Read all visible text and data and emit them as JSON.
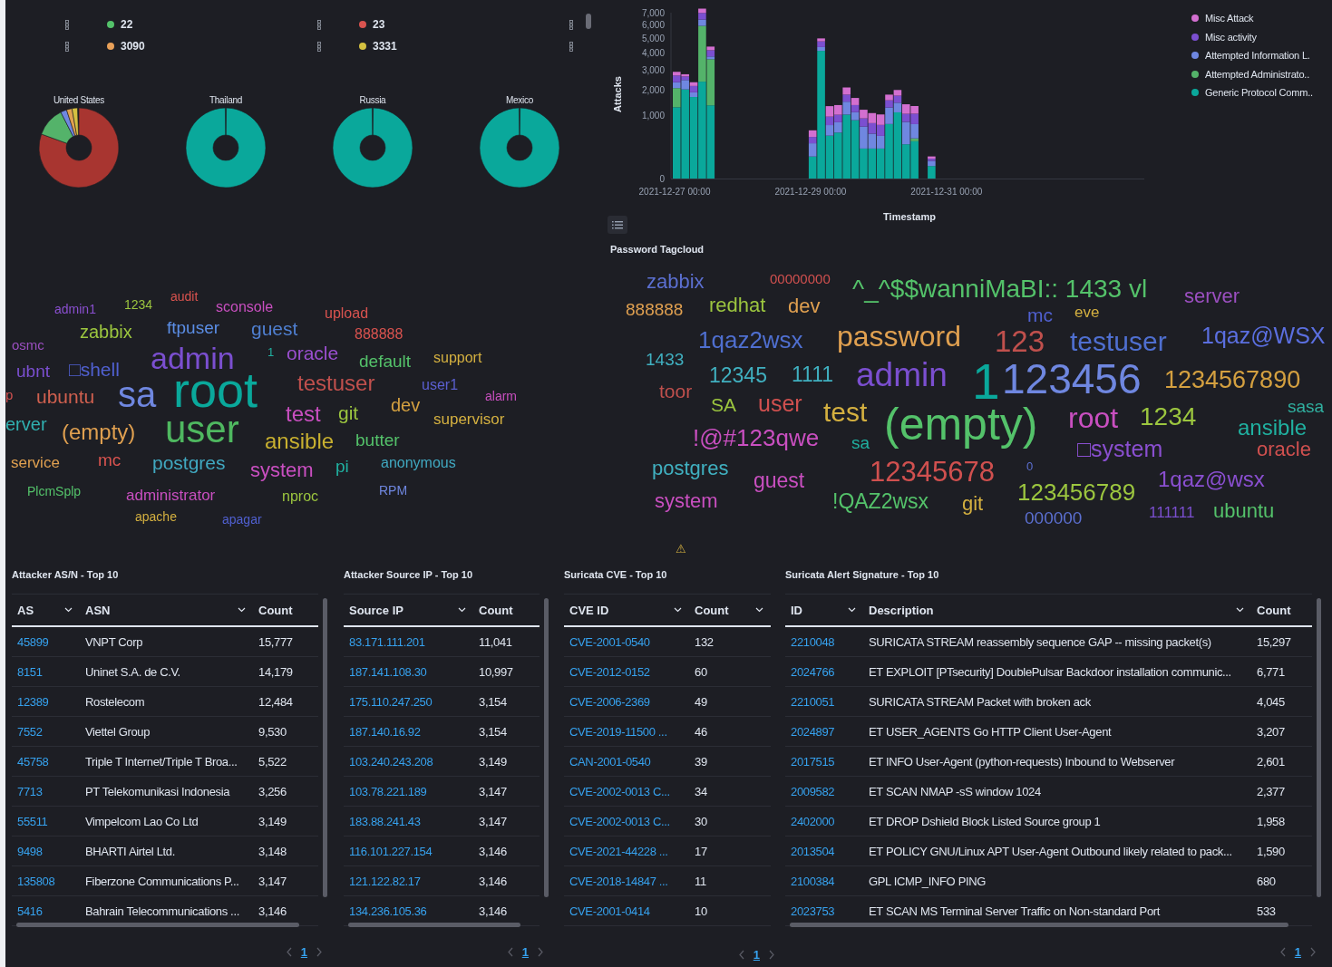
{
  "top_legend": {
    "rows": [
      {
        "items": [
          {
            "label": "22",
            "color": "#54c26a"
          },
          {
            "label": "23",
            "color": "#d9534f"
          }
        ]
      },
      {
        "items": [
          {
            "label": "3090",
            "color": "#e8a058"
          },
          {
            "label": "3331",
            "color": "#d4c040"
          }
        ]
      }
    ]
  },
  "country_donuts": [
    {
      "title": "United States",
      "kind": "mixed"
    },
    {
      "title": "Thailand",
      "kind": "single"
    },
    {
      "title": "Russia",
      "kind": "single"
    },
    {
      "title": "Mexico",
      "kind": "single"
    }
  ],
  "left_tagcloud": {
    "words": [
      {
        "text": "admin1",
        "color": "#8a4fd0"
      },
      {
        "text": "1234",
        "color": "#9cc63f"
      },
      {
        "text": "audit",
        "color": "#d9534f"
      },
      {
        "text": "sconsole",
        "color": "#c94fc0"
      },
      {
        "text": "upload",
        "color": "#d9534f"
      },
      {
        "text": "zabbix",
        "color": "#9cc63f"
      },
      {
        "text": "ftpuser",
        "color": "#5b8ee6"
      },
      {
        "text": "guest",
        "color": "#4f7fd0"
      },
      {
        "text": "888888",
        "color": "#d9534f"
      },
      {
        "text": "osmc",
        "color": "#9b4fc0"
      },
      {
        "text": "admin",
        "color": "#7b4fd0"
      },
      {
        "text": "1",
        "color": "#20b0a0"
      },
      {
        "text": "oracle",
        "color": "#9b4fd0"
      },
      {
        "text": "default",
        "color": "#54c26a"
      },
      {
        "text": "support",
        "color": "#d4b040"
      },
      {
        "text": "ubnt",
        "color": "#7b4fd0"
      },
      {
        "text": "□shell",
        "color": "#5060d0"
      },
      {
        "text": "p",
        "color": "#d0504f"
      },
      {
        "text": "ubuntu",
        "color": "#d0604f"
      },
      {
        "text": "sa",
        "color": "#6f87e0"
      },
      {
        "text": "root",
        "color": "#0aa89b"
      },
      {
        "text": "testuser",
        "color": "#c0504d"
      },
      {
        "text": "user1",
        "color": "#5b5fd0"
      },
      {
        "text": "alarm",
        "color": "#c94fc0"
      },
      {
        "text": "test",
        "color": "#c94fc0"
      },
      {
        "text": "git",
        "color": "#9cc63f"
      },
      {
        "text": "dev",
        "color": "#d4a040"
      },
      {
        "text": "erver",
        "color": "#30b0b0"
      },
      {
        "text": "(empty)",
        "color": "#e0a050"
      },
      {
        "text": "user",
        "color": "#4fb860"
      },
      {
        "text": "supervisor",
        "color": "#d4b040"
      },
      {
        "text": "ansible",
        "color": "#c8b030"
      },
      {
        "text": "butter",
        "color": "#54c26a"
      },
      {
        "text": "service",
        "color": "#e0a050"
      },
      {
        "text": "mc",
        "color": "#d9534f"
      },
      {
        "text": "postgres",
        "color": "#40a8c0"
      },
      {
        "text": "system",
        "color": "#c94fc0"
      },
      {
        "text": "pi",
        "color": "#20b0a0"
      },
      {
        "text": "anonymous",
        "color": "#40a8c0"
      },
      {
        "text": "PlcmSplp",
        "color": "#54c26a"
      },
      {
        "text": "administrator",
        "color": "#c94fc0"
      },
      {
        "text": "nproc",
        "color": "#9cc63f"
      },
      {
        "text": "RPM",
        "color": "#6f87e0"
      },
      {
        "text": "apache",
        "color": "#d4b040"
      },
      {
        "text": "apagar",
        "color": "#5060d0"
      }
    ]
  },
  "attacks_chart": {
    "y_title": "Attacks",
    "x_title": "Timestamp",
    "y_tick_labels": [
      "7,000",
      "6,000",
      "5,000",
      "4,000",
      "3,000",
      "2,000",
      "1,000",
      "0"
    ],
    "x_tick_labels": [
      "2021-12-27 00:00",
      "2021-12-29 00:00",
      "2021-12-31 00:00"
    ],
    "legend": [
      {
        "label": "Misc Attack",
        "color": "#d36fd0"
      },
      {
        "label": "Misc activity",
        "color": "#7b4fd0"
      },
      {
        "label": "Attempted Information L.",
        "color": "#6f87e0"
      },
      {
        "label": "Attempted Administrato..",
        "color": "#54b36a"
      },
      {
        "label": "Generic Protocol Comm..",
        "color": "#0aa89b"
      }
    ]
  },
  "password_tagcloud": {
    "title": "Password Tagcloud",
    "warning": "⚠",
    "words": [
      {
        "text": "zabbix",
        "color": "#5b6fd0"
      },
      {
        "text": "00000000",
        "color": "#d0504f"
      },
      {
        "text": "^_^$$wanniMaBI:: 1433 vl",
        "color": "#54c26a"
      },
      {
        "text": "server",
        "color": "#9b4fc0"
      },
      {
        "text": "888888",
        "color": "#e0a050"
      },
      {
        "text": "redhat",
        "color": "#9cc63f"
      },
      {
        "text": "dev",
        "color": "#e0a050"
      },
      {
        "text": "mc",
        "color": "#5060d0"
      },
      {
        "text": "eve",
        "color": "#d4b040"
      },
      {
        "text": "1qaz2wsx",
        "color": "#4f6fd0"
      },
      {
        "text": "password",
        "color": "#e0a050"
      },
      {
        "text": "123",
        "color": "#c0504d"
      },
      {
        "text": "testuser",
        "color": "#4f6fd0"
      },
      {
        "text": "1qaz@WSX",
        "color": "#5b6fe0"
      },
      {
        "text": "1433",
        "color": "#40b0c0"
      },
      {
        "text": "12345",
        "color": "#40b0c0"
      },
      {
        "text": "1111",
        "color": "#40b0c0"
      },
      {
        "text": "admin",
        "color": "#7b4fd0"
      },
      {
        "text": "1",
        "color": "#0aa89b"
      },
      {
        "text": "123456",
        "color": "#6f87e0"
      },
      {
        "text": "1234567890",
        "color": "#d4a040"
      },
      {
        "text": "toor",
        "color": "#c0504d"
      },
      {
        "text": "SA",
        "color": "#9cc63f"
      },
      {
        "text": "user",
        "color": "#d0504f"
      },
      {
        "text": "test",
        "color": "#d4b040"
      },
      {
        "text": "(empty)",
        "color": "#54c26a"
      },
      {
        "text": "root",
        "color": "#c94fc0"
      },
      {
        "text": "1234",
        "color": "#9cc63f"
      },
      {
        "text": "sasa",
        "color": "#30b0a0"
      },
      {
        "text": "ansible",
        "color": "#20b0a0"
      },
      {
        "text": "!@#123qwe",
        "color": "#c94fc0"
      },
      {
        "text": "sa",
        "color": "#20b0a0"
      },
      {
        "text": "□system",
        "color": "#8a4fd0"
      },
      {
        "text": "oracle",
        "color": "#d0504f"
      },
      {
        "text": "postgres",
        "color": "#40b0c0"
      },
      {
        "text": "guest",
        "color": "#c94fc0"
      },
      {
        "text": "12345678",
        "color": "#d0504f"
      },
      {
        "text": "0",
        "color": "#5b6fd0"
      },
      {
        "text": "1qaz@wsx",
        "color": "#8a4fd0"
      },
      {
        "text": "123456789",
        "color": "#9cc63f"
      },
      {
        "text": "system",
        "color": "#c94fc0"
      },
      {
        "text": "!QAZ2wsx",
        "color": "#54c26a"
      },
      {
        "text": "git",
        "color": "#d4b040"
      },
      {
        "text": "000000",
        "color": "#5b6fd0"
      },
      {
        "text": "111111",
        "color": "#7b4fd0"
      },
      {
        "text": "ubuntu",
        "color": "#54c26a"
      }
    ]
  },
  "tables": [
    {
      "title": "Attacker AS/N - Top 10",
      "columns": [
        {
          "label": "AS",
          "kind": "link",
          "sort_caret": true
        },
        {
          "label": "ASN",
          "kind": "text",
          "sort_caret": true
        },
        {
          "label": "Count",
          "kind": "text",
          "sort_caret": false
        }
      ],
      "rows": [
        [
          "45899",
          "VNPT Corp",
          "15,777"
        ],
        [
          "8151",
          "Uninet S.A. de C.V.",
          "14,179"
        ],
        [
          "12389",
          "Rostelecom",
          "12,484"
        ],
        [
          "7552",
          "Viettel Group",
          "9,530"
        ],
        [
          "45758",
          "Triple T Internet/Triple T Broa...",
          "5,522"
        ],
        [
          "7713",
          "PT Telekomunikasi Indonesia",
          "3,256"
        ],
        [
          "55511",
          "Vimpelcom Lao Co Ltd",
          "3,149"
        ],
        [
          "9498",
          "BHARTI Airtel Ltd.",
          "3,148"
        ],
        [
          "135808",
          "Fiberzone Communications P...",
          "3,147"
        ],
        [
          "5416",
          "Bahrain Telecommunications ...",
          "3,146"
        ]
      ],
      "page": "1"
    },
    {
      "title": "Attacker Source IP - Top 10",
      "columns": [
        {
          "label": "Source IP",
          "kind": "link",
          "sort_caret": true
        },
        {
          "label": "Count",
          "kind": "text",
          "sort_caret": false
        }
      ],
      "rows": [
        [
          "83.171.111.201",
          "11,041"
        ],
        [
          "187.141.108.30",
          "10,997"
        ],
        [
          "175.110.247.250",
          "3,154"
        ],
        [
          "187.140.16.92",
          "3,154"
        ],
        [
          "103.240.243.208",
          "3,149"
        ],
        [
          "103.78.221.189",
          "3,147"
        ],
        [
          "183.88.241.43",
          "3,147"
        ],
        [
          "116.101.227.154",
          "3,146"
        ],
        [
          "121.122.82.17",
          "3,146"
        ],
        [
          "134.236.105.36",
          "3,146"
        ]
      ],
      "page": "1"
    },
    {
      "title": "Suricata CVE - Top 10",
      "columns": [
        {
          "label": "CVE ID",
          "kind": "link",
          "sort_caret": true
        },
        {
          "label": "Count",
          "kind": "text",
          "sort_caret": true
        }
      ],
      "rows": [
        [
          "CVE-2001-0540",
          "132"
        ],
        [
          "CVE-2012-0152",
          "60"
        ],
        [
          "CVE-2006-2369",
          "49"
        ],
        [
          "CVE-2019-11500 ...",
          "46"
        ],
        [
          "CAN-2001-0540",
          "39"
        ],
        [
          "CVE-2002-0013 C...",
          "34"
        ],
        [
          "CVE-2002-0013 C...",
          "30"
        ],
        [
          "CVE-2021-44228 ...",
          "17"
        ],
        [
          "CVE-2018-14847 ...",
          "11"
        ],
        [
          "CVE-2001-0414",
          "10"
        ]
      ],
      "page": "1"
    },
    {
      "title": "Suricata Alert Signature - Top 10",
      "columns": [
        {
          "label": "ID",
          "kind": "link",
          "sort_caret": true
        },
        {
          "label": "Description",
          "kind": "text",
          "sort_caret": true
        },
        {
          "label": "Count",
          "kind": "text",
          "sort_caret": false
        }
      ],
      "rows": [
        [
          "2210048",
          "SURICATA STREAM reassembly sequence GAP -- missing packet(s)",
          "15,297"
        ],
        [
          "2024766",
          "ET EXPLOIT [PTsecurity] DoublePulsar Backdoor installation communic...",
          "6,771"
        ],
        [
          "2210051",
          "SURICATA STREAM Packet with broken ack",
          "4,045"
        ],
        [
          "2024897",
          "ET USER_AGENTS Go HTTP Client User-Agent",
          "3,207"
        ],
        [
          "2017515",
          "ET INFO User-Agent (python-requests) Inbound to Webserver",
          "2,601"
        ],
        [
          "2009582",
          "ET SCAN NMAP -sS window 1024",
          "2,377"
        ],
        [
          "2402000",
          "ET DROP Dshield Block Listed Source group 1",
          "1,958"
        ],
        [
          "2013504",
          "ET POLICY GNU/Linux APT User-Agent Outbound likely related to pack...",
          "1,590"
        ],
        [
          "2100384",
          "GPL ICMP_INFO PING",
          "680"
        ],
        [
          "2023753",
          "ET SCAN MS Terminal Server Traffic on Non-standard Port",
          "533"
        ]
      ],
      "page": "1"
    }
  ]
}
